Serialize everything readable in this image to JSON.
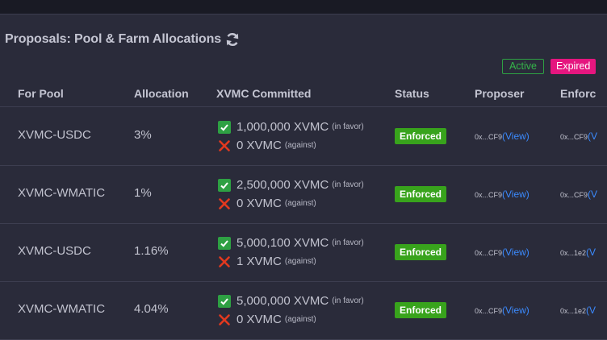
{
  "header": {
    "title": "Proposals: Pool & Farm Allocations",
    "refresh_icon": "refresh-icon"
  },
  "filters": {
    "active_label": "Active",
    "expired_label": "Expired"
  },
  "table": {
    "columns": [
      "For Pool",
      "Allocation",
      "XVMC Committed",
      "Status",
      "Proposer",
      "Enforc"
    ],
    "rows": [
      {
        "pool": "XVMC-USDC",
        "allocation": "3%",
        "favor_amount": "1,000,000 XVMC",
        "favor_label": "(in favor)",
        "against_amount": "0 XVMC",
        "against_label": "(against)",
        "status": "Enforced",
        "proposer": "0x...CF9",
        "proposer_link": "(View)",
        "enforcer": "0x...CF9",
        "enforcer_link": "(V"
      },
      {
        "pool": "XVMC-WMATIC",
        "allocation": "1%",
        "favor_amount": "2,500,000 XVMC",
        "favor_label": "(in favor)",
        "against_amount": "0 XVMC",
        "against_label": "(against)",
        "status": "Enforced",
        "proposer": "0x...CF9",
        "proposer_link": "(View)",
        "enforcer": "0x...CF9",
        "enforcer_link": "(V"
      },
      {
        "pool": "XVMC-USDC",
        "allocation": "1.16%",
        "favor_amount": "5,000,100 XVMC",
        "favor_label": "(in favor)",
        "against_amount": "1 XVMC",
        "against_label": "(against)",
        "status": "Enforced",
        "proposer": "0x...CF9",
        "proposer_link": "(View)",
        "enforcer": "0x...1e2",
        "enforcer_link": "(V"
      },
      {
        "pool": "XVMC-WMATIC",
        "allocation": "4.04%",
        "favor_amount": "5,000,000 XVMC",
        "favor_label": "(in favor)",
        "against_amount": "0 XVMC",
        "against_label": "(against)",
        "status": "Enforced",
        "proposer": "0x...CF9",
        "proposer_link": "(View)",
        "enforcer": "0x...1e2",
        "enforcer_link": "(V"
      }
    ]
  },
  "colors": {
    "background": "#2a2b3a",
    "active": "#35b54a",
    "expired": "#e5167f",
    "enforced": "#38a31c",
    "link": "#3b8bff"
  }
}
